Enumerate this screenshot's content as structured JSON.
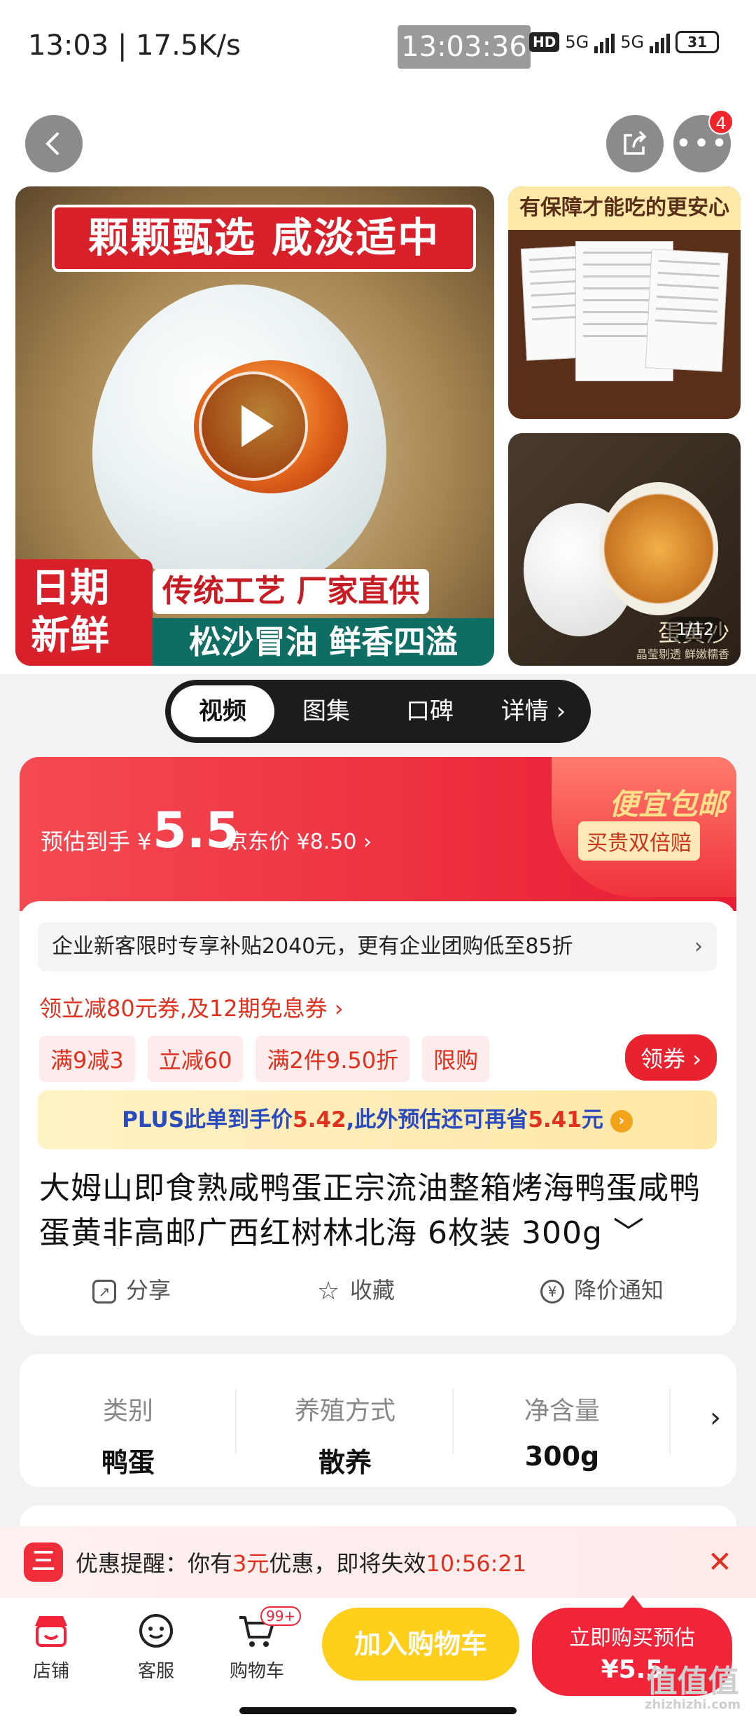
{
  "status": {
    "time_speed": "13:03 | 17.5K/s",
    "clock": "13:03:36",
    "hd": "HD",
    "net1": "5G",
    "net2": "5G",
    "battery": "31"
  },
  "nav": {
    "badge": "4",
    "back_icon": "chevron-left-icon",
    "share_icon": "share-icon",
    "more_icon": "more-icon"
  },
  "gallery": {
    "main_top": "颗颗甄选 咸淡适中",
    "main_left_l1": "日期",
    "main_left_l2": "新鲜",
    "main_b1": "传统工艺 厂家直供",
    "main_b2": "松沙冒油 鲜香四溢",
    "side1_title": "有保障才能吃的更安心",
    "side2_text": "蛋黄沙",
    "side2_sub": "晶莹剔透 鲜嫩糯香",
    "counter": "1/12"
  },
  "tabs": [
    "视频",
    "图集",
    "口碑",
    "详情 ›"
  ],
  "price": {
    "pre": "预估到手 ¥",
    "amount": "5.5",
    "jd": "京东价 ¥8.50 ›",
    "baoyou": "便宜包邮",
    "double": "买贵双倍赔"
  },
  "notice": {
    "text": "企业新客限时专享补贴2040元，更有企业团购低至85折",
    "arrow": "›"
  },
  "coupon_link": "领立减80元券,及12期免息券 ›",
  "tags": [
    "满9减3",
    "立减60",
    "满2件9.50折",
    "限购"
  ],
  "get_coupon": "领券 ›",
  "plus": {
    "a": "PLUS此单到手价",
    "p1": "5.42",
    "b": ",此外预估还可再省",
    "p2": "5.41",
    "c": "元",
    "icon": "›"
  },
  "title": "大姆山即食熟咸鸭蛋正宗流油整箱烤海鸭蛋咸鸭蛋黄非高邮广西红树林北海 6枚装 300g ﹀",
  "actions": [
    "分享",
    "收藏",
    "降价通知"
  ],
  "attrs": [
    {
      "k": "类别",
      "v": "鸭蛋"
    },
    {
      "k": "养殖方式",
      "v": "散养"
    },
    {
      "k": "净含量",
      "v": "300g"
    }
  ],
  "attr_arrow": "›",
  "toast": {
    "pre": "优惠提醒：你有",
    "amt": "3元",
    "mid": "优惠，即将失效",
    "time": "10:56:21",
    "close": "✕",
    "icon": "三"
  },
  "bottom": {
    "shop": "店铺",
    "service": "客服",
    "cart": "购物车",
    "cart_badge": "99+",
    "add_cart": "加入购物车",
    "buy_l1": "立即购买预估",
    "buy_l2": "¥5.5"
  },
  "watermark": {
    "big": "值值值",
    "small": "zhizhizhi.com"
  }
}
